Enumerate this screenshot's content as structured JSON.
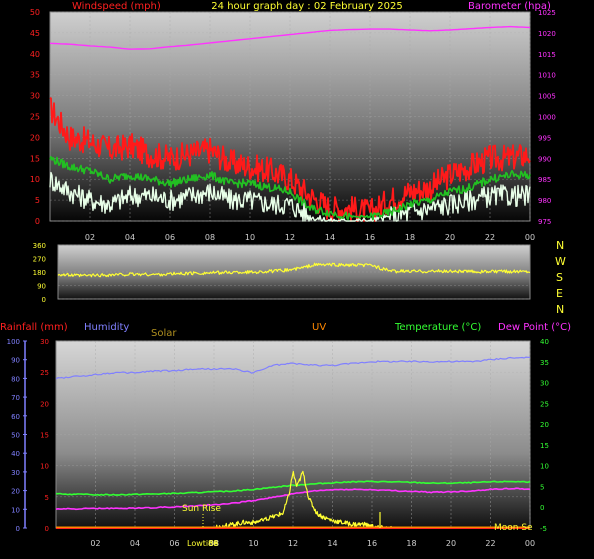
{
  "colors": {
    "wind_axis": "#ff2020",
    "baro": "#ff33ff",
    "wind_max": "#ff1a1a",
    "wind_avg": "#22c022",
    "wind_min": "#e8ffe8",
    "wind_dir": "#ffff33",
    "humidity": "#8080ff",
    "solar": "#b09020",
    "uv": "#ff8800",
    "temperature": "#33ff33",
    "dew_point": "#ff33ff",
    "rain": "#ff2222",
    "compass": "#ffff33"
  },
  "panel_top": {
    "title": "24 hour graph day : 02 February 2025",
    "left_label": "Windspeed (mph)",
    "right_label": "Barometer (hpa)"
  },
  "panel_bottom": {
    "rain_label": "Rainfall (mm)",
    "humidity_label": "Humidity",
    "solar_label": "Solar",
    "uv_label": "UV",
    "temp_label": "Temperature (°C)",
    "dew_label": "Dew Point (°C)",
    "sunrise_label": "Sun Rise",
    "lowtide_label": "Lowtide",
    "lowtide_value": "88",
    "moonset_label": "Moon Se"
  },
  "compass": [
    "N",
    "W",
    "S",
    "E",
    "N"
  ],
  "chart_data": [
    {
      "type": "line",
      "name": "wind-barometer",
      "x_ticks": [
        "02",
        "04",
        "06",
        "08",
        "10",
        "12",
        "14",
        "16",
        "18",
        "20",
        "22",
        "00"
      ],
      "left_ticks": [
        "50",
        "45",
        "40",
        "35",
        "30",
        "25",
        "20",
        "15",
        "10",
        "5",
        "0"
      ],
      "right_ticks": [
        "1025",
        "1020",
        "1015",
        "1010",
        "1005",
        "1000",
        "995",
        "990",
        "985",
        "980",
        "975"
      ],
      "ylim_left": [
        0,
        50
      ],
      "ylim_right": [
        975,
        1025
      ],
      "xlim_hours": [
        0,
        24
      ],
      "series": [
        {
          "key": "barometer",
          "axis": "right",
          "x": [
            0,
            1,
            2,
            3,
            4,
            5,
            6,
            7,
            8,
            9,
            10,
            11,
            12,
            13,
            14,
            15,
            16,
            17,
            18,
            19,
            20,
            21,
            22,
            23,
            24
          ],
          "values": [
            1017.5,
            1017.3,
            1016.9,
            1016.6,
            1016.1,
            1016.2,
            1016.7,
            1017.1,
            1017.6,
            1018.1,
            1018.6,
            1019.1,
            1019.6,
            1020.1,
            1020.6,
            1020.8,
            1020.9,
            1020.9,
            1020.7,
            1020.5,
            1020.7,
            1021.0,
            1021.3,
            1021.5,
            1021.3
          ]
        },
        {
          "key": "wind_max",
          "axis": "left",
          "x": [
            0,
            1,
            2,
            3,
            4,
            5,
            6,
            7,
            8,
            9,
            10,
            11,
            12,
            13,
            14,
            15,
            16,
            17,
            18,
            19,
            20,
            21,
            22,
            23,
            24
          ],
          "values": [
            27,
            20,
            19,
            17,
            18,
            16,
            15,
            16,
            17,
            14,
            13,
            12,
            10,
            6,
            3,
            3,
            2,
            5,
            7,
            8,
            11,
            13,
            15,
            15,
            16
          ]
        },
        {
          "key": "wind_avg",
          "axis": "left",
          "x": [
            0,
            1,
            2,
            3,
            4,
            5,
            6,
            7,
            8,
            9,
            10,
            11,
            12,
            13,
            14,
            15,
            16,
            17,
            18,
            19,
            20,
            21,
            22,
            23,
            24
          ],
          "values": [
            15,
            13,
            12,
            10,
            11,
            10,
            9,
            10,
            11,
            9,
            9,
            8,
            7,
            3,
            2,
            1,
            1,
            2,
            4,
            5,
            7,
            8,
            10,
            11,
            11
          ]
        },
        {
          "key": "wind_min",
          "axis": "left",
          "x": [
            0,
            1,
            2,
            3,
            4,
            5,
            6,
            7,
            8,
            9,
            10,
            11,
            12,
            13,
            14,
            15,
            16,
            17,
            18,
            19,
            20,
            21,
            22,
            23,
            24
          ],
          "values": [
            10,
            7,
            5,
            4,
            6,
            6,
            5,
            6,
            7,
            5,
            5,
            4,
            4,
            1,
            0,
            0,
            0,
            1,
            2,
            3,
            4,
            5,
            6,
            6,
            6
          ]
        }
      ]
    },
    {
      "type": "line",
      "name": "wind-direction",
      "y_ticks": [
        "360",
        "270",
        "180",
        "90",
        "0"
      ],
      "ylim": [
        0,
        360
      ],
      "xlim_hours": [
        0,
        24
      ],
      "series": [
        {
          "key": "wind_dir",
          "x": [
            0,
            1,
            2,
            3,
            4,
            5,
            6,
            7,
            8,
            9,
            10,
            11,
            12,
            12.5,
            13,
            14,
            15,
            16,
            16.5,
            17,
            18,
            19,
            20,
            21,
            22,
            23,
            24
          ],
          "values": [
            165,
            155,
            158,
            162,
            165,
            163,
            168,
            172,
            175,
            178,
            180,
            185,
            198,
            210,
            228,
            228,
            225,
            225,
            200,
            185,
            185,
            185,
            185,
            183,
            182,
            184,
            185
          ]
        }
      ]
    },
    {
      "type": "line",
      "name": "rain-humidity-temperature",
      "x_ticks": [
        "02",
        "04",
        "06",
        "08",
        "10",
        "12",
        "14",
        "16",
        "18",
        "20",
        "22",
        "00"
      ],
      "humidity_ticks": [
        "100",
        "90",
        "80",
        "70",
        "60",
        "50",
        "40",
        "30",
        "20",
        "10",
        "0"
      ],
      "rain_ticks": [
        "30",
        "25",
        "20",
        "15",
        "10",
        "5",
        "0"
      ],
      "temp_ticks": [
        "40",
        "35",
        "30",
        "25",
        "20",
        "15",
        "10",
        "5",
        "0",
        "-5"
      ],
      "ylim_humidity": [
        0,
        100
      ],
      "ylim_rain": [
        0,
        30
      ],
      "ylim_temp": [
        -5,
        40
      ],
      "xlim_hours": [
        0,
        24
      ],
      "series": [
        {
          "key": "humidity",
          "axis": "humidity",
          "x": [
            0,
            1,
            2,
            3,
            4,
            5,
            6,
            7,
            8,
            9,
            10,
            11,
            12,
            13,
            14,
            15,
            16,
            17,
            18,
            19,
            20,
            21,
            22,
            23,
            24
          ],
          "values": [
            80,
            81,
            82,
            83,
            83,
            84,
            84,
            85,
            85,
            85,
            83,
            87,
            88,
            87,
            87,
            88,
            89,
            89,
            89,
            89,
            89,
            89,
            90,
            91,
            91
          ]
        },
        {
          "key": "temperature",
          "axis": "temp",
          "x": [
            0,
            1,
            2,
            3,
            4,
            5,
            6,
            7,
            8,
            9,
            10,
            11,
            12,
            13,
            14,
            15,
            16,
            17,
            18,
            19,
            20,
            21,
            22,
            23,
            24
          ],
          "values": [
            3.2,
            3.1,
            3.0,
            3.0,
            3.1,
            3.2,
            3.3,
            3.5,
            3.7,
            3.9,
            4.3,
            4.8,
            5.3,
            5.6,
            5.9,
            6.1,
            6.2,
            6.1,
            6.0,
            5.8,
            5.8,
            5.9,
            6.1,
            6.2,
            6.1
          ]
        },
        {
          "key": "dew_point",
          "axis": "temp",
          "x": [
            0,
            1,
            2,
            3,
            4,
            5,
            6,
            7,
            8,
            9,
            10,
            11,
            12,
            13,
            14,
            15,
            16,
            17,
            18,
            19,
            20,
            21,
            22,
            23,
            24
          ],
          "values": [
            -0.4,
            -0.4,
            -0.3,
            -0.3,
            -0.2,
            -0.1,
            0.1,
            0.3,
            0.6,
            1.0,
            1.6,
            2.4,
            3.2,
            3.9,
            4.2,
            4.3,
            4.2,
            4.0,
            3.8,
            3.6,
            3.7,
            3.9,
            4.3,
            4.5,
            4.4
          ]
        },
        {
          "key": "solar",
          "axis": "humidity",
          "x": [
            8,
            8.5,
            9,
            9.5,
            10,
            10.5,
            11,
            11.5,
            11.8,
            12,
            12.2,
            12.5,
            12.8,
            13.2,
            13.5,
            14,
            14.5,
            15,
            15.5,
            16,
            16.5,
            17
          ],
          "values": [
            0,
            1,
            2,
            3,
            3,
            4,
            6,
            8,
            18,
            30,
            22,
            30,
            16,
            8,
            6,
            4,
            3,
            2,
            2,
            1,
            0,
            0
          ]
        },
        {
          "key": "uv",
          "axis": "humidity",
          "x": [
            0,
            24
          ],
          "values": [
            0,
            0
          ]
        },
        {
          "key": "rain",
          "axis": "rain",
          "x": [
            0,
            24
          ],
          "values": [
            0,
            0
          ]
        }
      ]
    }
  ]
}
